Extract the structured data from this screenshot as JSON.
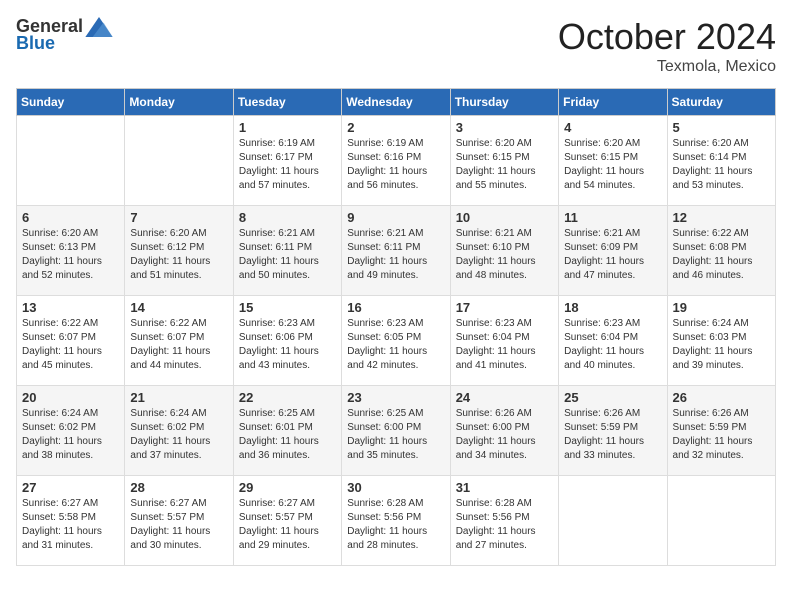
{
  "header": {
    "logo_general": "General",
    "logo_blue": "Blue",
    "month": "October 2024",
    "location": "Texmola, Mexico"
  },
  "days_of_week": [
    "Sunday",
    "Monday",
    "Tuesday",
    "Wednesday",
    "Thursday",
    "Friday",
    "Saturday"
  ],
  "weeks": [
    [
      {
        "day": "",
        "content": ""
      },
      {
        "day": "",
        "content": ""
      },
      {
        "day": "1",
        "content": "Sunrise: 6:19 AM\nSunset: 6:17 PM\nDaylight: 11 hours and 57 minutes."
      },
      {
        "day": "2",
        "content": "Sunrise: 6:19 AM\nSunset: 6:16 PM\nDaylight: 11 hours and 56 minutes."
      },
      {
        "day": "3",
        "content": "Sunrise: 6:20 AM\nSunset: 6:15 PM\nDaylight: 11 hours and 55 minutes."
      },
      {
        "day": "4",
        "content": "Sunrise: 6:20 AM\nSunset: 6:15 PM\nDaylight: 11 hours and 54 minutes."
      },
      {
        "day": "5",
        "content": "Sunrise: 6:20 AM\nSunset: 6:14 PM\nDaylight: 11 hours and 53 minutes."
      }
    ],
    [
      {
        "day": "6",
        "content": "Sunrise: 6:20 AM\nSunset: 6:13 PM\nDaylight: 11 hours and 52 minutes."
      },
      {
        "day": "7",
        "content": "Sunrise: 6:20 AM\nSunset: 6:12 PM\nDaylight: 11 hours and 51 minutes."
      },
      {
        "day": "8",
        "content": "Sunrise: 6:21 AM\nSunset: 6:11 PM\nDaylight: 11 hours and 50 minutes."
      },
      {
        "day": "9",
        "content": "Sunrise: 6:21 AM\nSunset: 6:11 PM\nDaylight: 11 hours and 49 minutes."
      },
      {
        "day": "10",
        "content": "Sunrise: 6:21 AM\nSunset: 6:10 PM\nDaylight: 11 hours and 48 minutes."
      },
      {
        "day": "11",
        "content": "Sunrise: 6:21 AM\nSunset: 6:09 PM\nDaylight: 11 hours and 47 minutes."
      },
      {
        "day": "12",
        "content": "Sunrise: 6:22 AM\nSunset: 6:08 PM\nDaylight: 11 hours and 46 minutes."
      }
    ],
    [
      {
        "day": "13",
        "content": "Sunrise: 6:22 AM\nSunset: 6:07 PM\nDaylight: 11 hours and 45 minutes."
      },
      {
        "day": "14",
        "content": "Sunrise: 6:22 AM\nSunset: 6:07 PM\nDaylight: 11 hours and 44 minutes."
      },
      {
        "day": "15",
        "content": "Sunrise: 6:23 AM\nSunset: 6:06 PM\nDaylight: 11 hours and 43 minutes."
      },
      {
        "day": "16",
        "content": "Sunrise: 6:23 AM\nSunset: 6:05 PM\nDaylight: 11 hours and 42 minutes."
      },
      {
        "day": "17",
        "content": "Sunrise: 6:23 AM\nSunset: 6:04 PM\nDaylight: 11 hours and 41 minutes."
      },
      {
        "day": "18",
        "content": "Sunrise: 6:23 AM\nSunset: 6:04 PM\nDaylight: 11 hours and 40 minutes."
      },
      {
        "day": "19",
        "content": "Sunrise: 6:24 AM\nSunset: 6:03 PM\nDaylight: 11 hours and 39 minutes."
      }
    ],
    [
      {
        "day": "20",
        "content": "Sunrise: 6:24 AM\nSunset: 6:02 PM\nDaylight: 11 hours and 38 minutes."
      },
      {
        "day": "21",
        "content": "Sunrise: 6:24 AM\nSunset: 6:02 PM\nDaylight: 11 hours and 37 minutes."
      },
      {
        "day": "22",
        "content": "Sunrise: 6:25 AM\nSunset: 6:01 PM\nDaylight: 11 hours and 36 minutes."
      },
      {
        "day": "23",
        "content": "Sunrise: 6:25 AM\nSunset: 6:00 PM\nDaylight: 11 hours and 35 minutes."
      },
      {
        "day": "24",
        "content": "Sunrise: 6:26 AM\nSunset: 6:00 PM\nDaylight: 11 hours and 34 minutes."
      },
      {
        "day": "25",
        "content": "Sunrise: 6:26 AM\nSunset: 5:59 PM\nDaylight: 11 hours and 33 minutes."
      },
      {
        "day": "26",
        "content": "Sunrise: 6:26 AM\nSunset: 5:59 PM\nDaylight: 11 hours and 32 minutes."
      }
    ],
    [
      {
        "day": "27",
        "content": "Sunrise: 6:27 AM\nSunset: 5:58 PM\nDaylight: 11 hours and 31 minutes."
      },
      {
        "day": "28",
        "content": "Sunrise: 6:27 AM\nSunset: 5:57 PM\nDaylight: 11 hours and 30 minutes."
      },
      {
        "day": "29",
        "content": "Sunrise: 6:27 AM\nSunset: 5:57 PM\nDaylight: 11 hours and 29 minutes."
      },
      {
        "day": "30",
        "content": "Sunrise: 6:28 AM\nSunset: 5:56 PM\nDaylight: 11 hours and 28 minutes."
      },
      {
        "day": "31",
        "content": "Sunrise: 6:28 AM\nSunset: 5:56 PM\nDaylight: 11 hours and 27 minutes."
      },
      {
        "day": "",
        "content": ""
      },
      {
        "day": "",
        "content": ""
      }
    ]
  ]
}
